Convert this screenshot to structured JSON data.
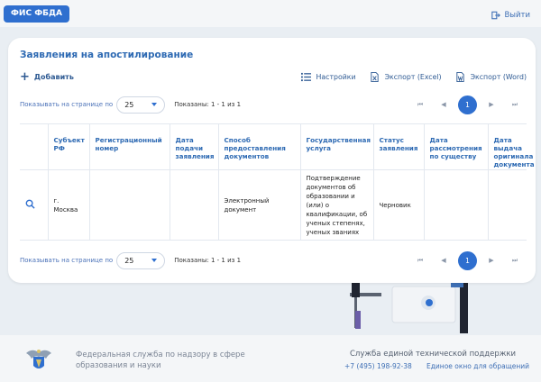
{
  "header": {
    "brand": "ФИС ФБДА",
    "logout_label": "Выйти"
  },
  "page": {
    "title": "Заявления на апостилирование"
  },
  "toolbar": {
    "add_label": "Добавить",
    "settings_label": "Настройки",
    "export_excel_label": "Экспорт (Excel)",
    "export_word_label": "Экспорт (Word)"
  },
  "pager_top": {
    "per_page_label": "Показывать на странице по",
    "per_page_value": "25",
    "shown_label": "Показаны: 1 - 1 из 1",
    "current_page": "1",
    "first": "⏮",
    "prev": "◀",
    "next": "▶",
    "last": "⏭"
  },
  "pager_bottom": {
    "per_page_label": "Показывать на странице по",
    "per_page_value": "25",
    "shown_label": "Показаны: 1 - 1 из 1",
    "current_page": "1"
  },
  "table": {
    "columns": [
      "",
      "Субъект РФ",
      "Регистрационный номер",
      "Дата подачи заявления",
      "Способ предоставления документов",
      "Государственная услуга",
      "Статус заявления",
      "Дата рассмотрения по существу",
      "Дата выдача оригинала документа"
    ],
    "rows": [
      {
        "subject": "г. Москва",
        "reg_number": "",
        "submit_date": "",
        "delivery_method": "Электронный документ",
        "service": "Подтверждение документов об образовании и (или) о квалификации, об ученых степенях, ученых званиях",
        "status": "Черновик",
        "review_date": "",
        "issue_date": ""
      }
    ]
  },
  "footer": {
    "org_name": "Федеральная служба по надзору в сфере образования и науки",
    "support_title": "Служба единой технической поддержки",
    "support_phone": "+7 (495) 198-92-38",
    "support_link": "Единое окно для обращений"
  },
  "colors": {
    "accent": "#2f6fcf",
    "title": "#2e6ab3",
    "background": "#e9eef3"
  }
}
